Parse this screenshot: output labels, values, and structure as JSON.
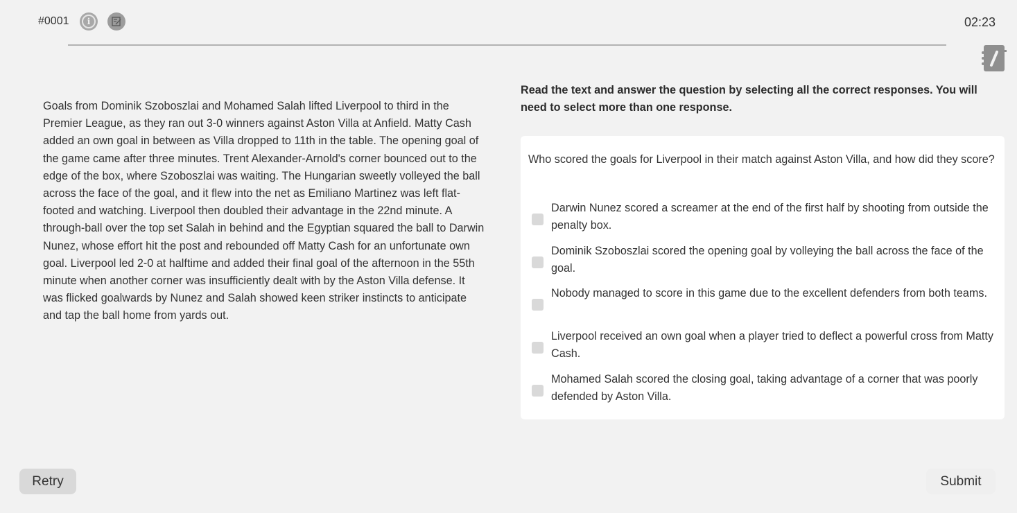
{
  "header": {
    "question_id": "#0001",
    "timer": "02:23",
    "icons": {
      "info": "info-icon",
      "notes": "notes-icon",
      "notepad": "notepad-icon"
    }
  },
  "passage": {
    "text": "Goals from Dominik Szoboszlai and Mohamed Salah lifted Liverpool to third in the Premier League, as they ran out 3-0 winners against Aston Villa at Anfield. Matty Cash added an own goal in between as Villa dropped to 11th in the table. The opening goal of the game came after three minutes. Trent Alexander-Arnold's corner bounced out to the edge of the box, where Szoboszlai was waiting. The Hungarian sweetly volleyed the ball across the face of the goal, and it flew into the net as Emiliano Martinez was left flat-footed and watching. Liverpool then doubled their advantage in the 22nd minute. A through-ball over the top set Salah in behind and the Egyptian squared the ball to Darwin Nunez, whose effort hit the post and rebounded off Matty Cash for an unfortunate own goal. Liverpool led 2-0 at halftime and added their final goal of the afternoon in the 55th minute when another corner was insufficiently dealt with by the Aston Villa defense. It was flicked goalwards by Nunez and Salah showed keen striker instincts to anticipate and tap the ball home from yards out."
  },
  "instructions": "Read the text and answer the question by selecting all the correct responses. You will need to select more than one response.",
  "question": {
    "text": "Who scored the goals for Liverpool in their match against Aston Villa, and how did they score?",
    "options": [
      {
        "label": "Darwin Nunez scored a screamer at the end of the first half by shooting from outside the penalty box.",
        "checked": false
      },
      {
        "label": "Dominik Szoboszlai scored the opening goal by volleying the ball across the face of the goal.",
        "checked": false
      },
      {
        "label": "Nobody managed to score in this game due to the excellent defenders from both teams.",
        "checked": false
      },
      {
        "label": "Liverpool received an own goal when a player tried to deflect a powerful cross from Matty Cash.",
        "checked": false
      },
      {
        "label": "Mohamed Salah scored the closing goal, taking advantage of a corner that was poorly defended by Aston Villa.",
        "checked": false
      }
    ]
  },
  "footer": {
    "retry_label": "Retry",
    "submit_label": "Submit"
  },
  "colors": {
    "background": "#f2f2f2",
    "card": "#ffffff",
    "checkbox": "#d9d9d9",
    "retry_button": "#d9d9d9",
    "icon_gray": "#9c9c9c"
  }
}
